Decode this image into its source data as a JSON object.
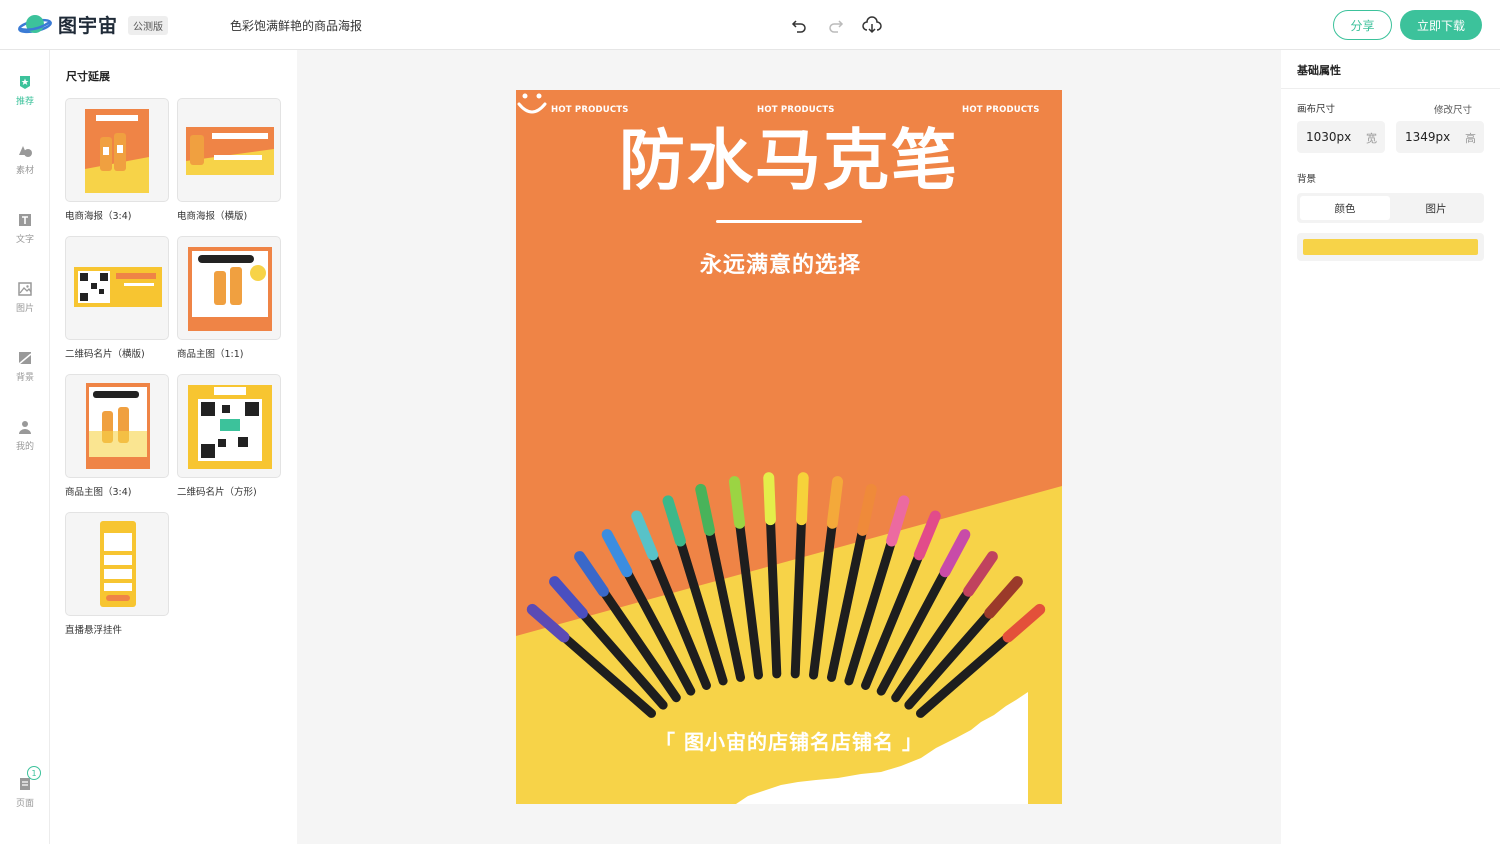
{
  "header": {
    "logo_text": "图宇宙",
    "beta": "公测版",
    "doc_title": "色彩饱满鲜艳的商品海报",
    "share": "分享",
    "download": "立即下载"
  },
  "nav": [
    {
      "label": "推荐",
      "icon": "star-icon"
    },
    {
      "label": "素材",
      "icon": "shapes-icon"
    },
    {
      "label": "文字",
      "icon": "text-icon"
    },
    {
      "label": "图片",
      "icon": "image-icon"
    },
    {
      "label": "背景",
      "icon": "background-icon"
    },
    {
      "label": "我的",
      "icon": "user-icon"
    }
  ],
  "pages": {
    "label": "页面",
    "count": "1"
  },
  "panel": {
    "title": "尺寸延展",
    "templates": [
      {
        "label": "电商海报（3:4)"
      },
      {
        "label": "电商海报（横版)"
      },
      {
        "label": "二维码名片（横版)"
      },
      {
        "label": "商品主图（1:1)"
      },
      {
        "label": "商品主图（3:4)"
      },
      {
        "label": "二维码名片（方形)"
      },
      {
        "label": "直播悬浮挂件"
      }
    ]
  },
  "poster": {
    "hot1": "HOT PRODUCTS",
    "hot2": "HOT PRODUCTS",
    "hot3": "HOT PRODUCTS",
    "title": "防水马克笔",
    "subtitle": "永远满意的选择",
    "shop": "「 图小宙的店铺名店铺名 」",
    "colors": {
      "orange": "#ef8446",
      "yellow": "#f7d348",
      "white": "#ffffff"
    }
  },
  "props": {
    "title": "基础属性",
    "canvas_size_label": "画布尺寸",
    "edit_size": "修改尺寸",
    "width_value": "1030px",
    "width_unit": "宽",
    "height_value": "1349px",
    "height_unit": "高",
    "background_label": "背景",
    "tab_color": "颜色",
    "tab_image": "图片",
    "bg_color": "#f7d348"
  },
  "accent": "#3cc29b"
}
